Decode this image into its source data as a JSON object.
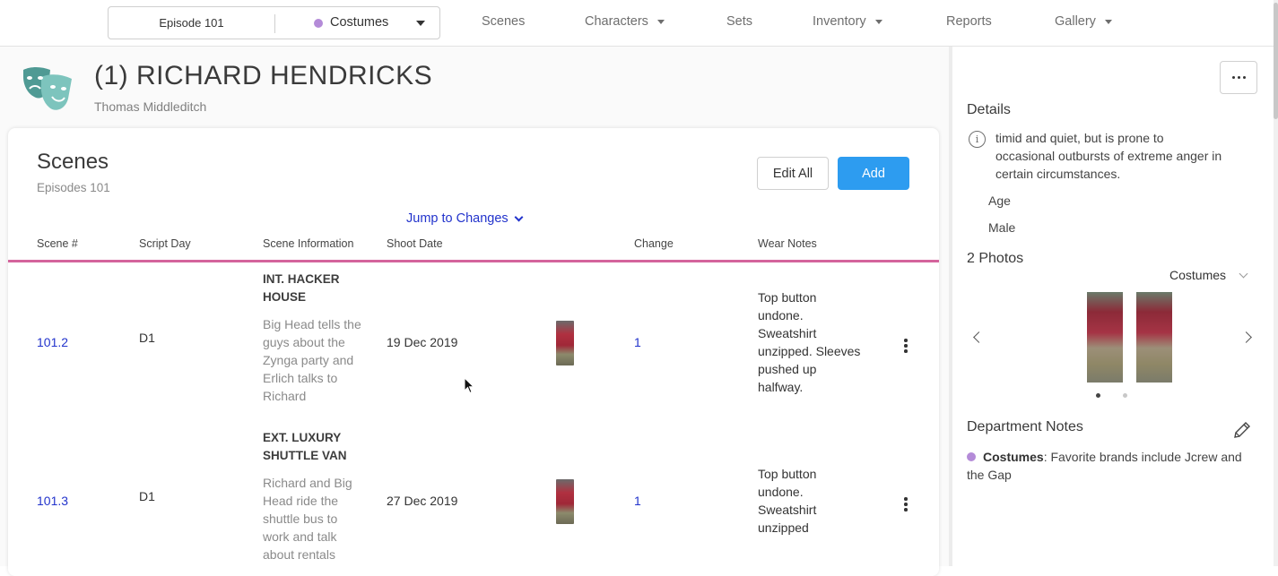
{
  "topnav": {
    "episode_label": "Episode 101",
    "department_label": "Costumes",
    "department_color": "#b48bd8",
    "items": [
      {
        "label": "Scenes",
        "has_caret": false
      },
      {
        "label": "Characters",
        "has_caret": true
      },
      {
        "label": "Sets",
        "has_caret": false
      },
      {
        "label": "Inventory",
        "has_caret": true
      },
      {
        "label": "Reports",
        "has_caret": false
      },
      {
        "label": "Gallery",
        "has_caret": true
      }
    ]
  },
  "character": {
    "title": "(1) RICHARD HENDRICKS",
    "actor": "Thomas Middleditch",
    "icon": "theater-masks-icon",
    "icon_color": "#4f9a94"
  },
  "scenes_card": {
    "title": "Scenes",
    "subtitle": "Episodes 101",
    "edit_all_label": "Edit All",
    "add_label": "Add",
    "add_color": "#2d9cf0",
    "jump_label": "Jump to Changes",
    "accent_line_color": "#d4649c",
    "columns": [
      "Scene #",
      "Script Day",
      "Scene Information",
      "Shoot Date",
      "Change",
      "Wear Notes"
    ],
    "rows": [
      {
        "scene": "101.2",
        "script_day": "D1",
        "heading_line1": "INT. HACKER",
        "heading_line2": "HOUSE",
        "desc": [
          "Big Head tells the",
          "guys about the",
          "Zynga party and",
          "Erlich talks to",
          "Richard"
        ],
        "shoot_date": "19 Dec 2019",
        "change": "1",
        "wear_notes": [
          "Top button",
          "undone.",
          "Sweatshirt",
          "unzipped. Sleeves",
          "pushed up",
          "halfway."
        ]
      },
      {
        "scene": "101.3",
        "script_day": "D1",
        "heading_line1": "EXT. LUXURY",
        "heading_line2": "SHUTTLE VAN",
        "desc": [
          "Richard and Big",
          "Head ride the",
          "shuttle bus to",
          "work and talk",
          "about rentals"
        ],
        "shoot_date": "27 Dec 2019",
        "change": "1",
        "wear_notes": [
          "Top button",
          "undone.",
          "Sweatshirt",
          "unzipped"
        ]
      }
    ]
  },
  "details": {
    "heading": "Details",
    "description": [
      "timid and quiet, but is prone to",
      "occasional outbursts of extreme anger in",
      "certain circumstances."
    ],
    "age_label": "Age",
    "gender": "Male"
  },
  "photos": {
    "heading": "2 Photos",
    "department": "Costumes",
    "count": 2,
    "active_index": 0
  },
  "dept_notes": {
    "heading": "Department Notes",
    "department": "Costumes",
    "text": ": Favorite brands include Jcrew and",
    "text_line2": "the Gap"
  }
}
